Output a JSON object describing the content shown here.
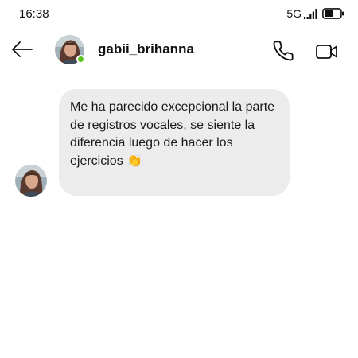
{
  "status_bar": {
    "time": "16:38",
    "network": "5G",
    "icons": [
      "signal-icon",
      "battery-icon"
    ]
  },
  "header": {
    "username": "gabii_brihanna",
    "online": true,
    "icons": [
      "back-arrow-icon",
      "phone-icon",
      "video-camera-icon"
    ]
  },
  "messages": [
    {
      "text": "Me ha parecido excepcional la parte de registros vocales, se siente la diferencia luego de hacer los ejercicios 👏",
      "from": "gabii_brihanna"
    }
  ],
  "colors": {
    "bubble": "#ececec",
    "online": "#58c322",
    "background": "#ffffff"
  }
}
